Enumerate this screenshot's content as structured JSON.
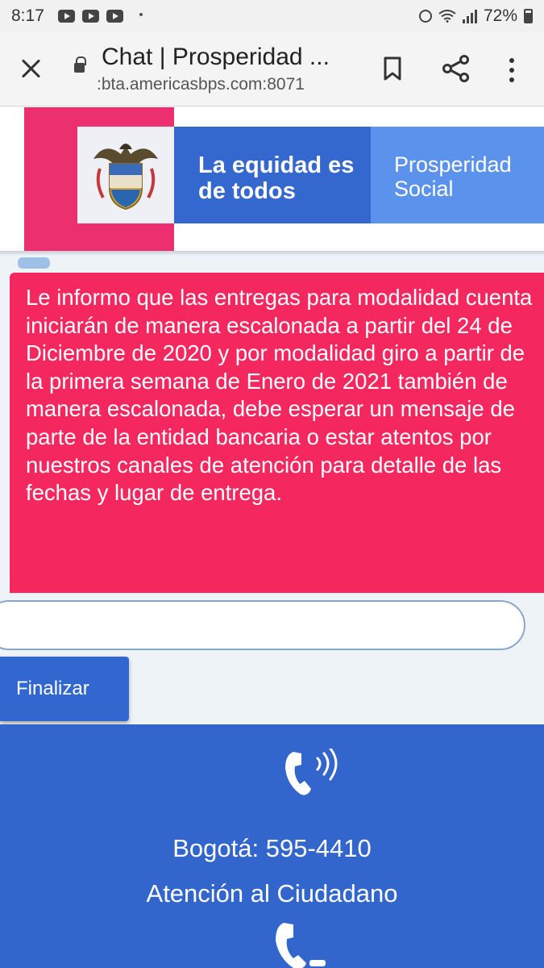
{
  "status_bar": {
    "time": "8:17",
    "battery": "72%"
  },
  "browser": {
    "page_title": "Chat | Prosperidad ...",
    "url": ":bta.americasbps.com:8071"
  },
  "banner": {
    "motto": "La equidad es de todos",
    "brand": "Prosperidad Social"
  },
  "chat": {
    "message": "Le informo que las entregas para modalidad cuenta iniciarán de manera escalonada a partir del 24 de Diciembre de 2020 y por modalidad giro a partir de la primera semana de Enero de 2021 también de manera escalonada, debe esperar un mensaje de parte de la entidad bancaria o estar atentos por nuestros canales de atención para detalle de las fechas y lugar de entrega.",
    "input_value": "",
    "finish_label": "Finalizar"
  },
  "footer": {
    "phone": "Bogotá: 595-4410",
    "label": "Atención al Ciudadano"
  },
  "colors": {
    "brand_pink": "#f4285f",
    "brand_blue": "#3366cc",
    "light_blue": "#5b93ec"
  }
}
